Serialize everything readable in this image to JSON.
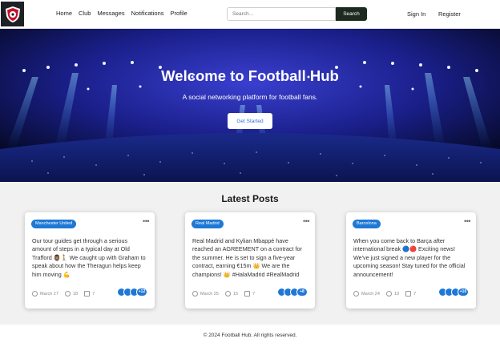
{
  "nav": {
    "items": [
      "Home",
      "Club",
      "Messages",
      "Notifications",
      "Profile"
    ]
  },
  "search": {
    "placeholder": "Search...",
    "button": "Search"
  },
  "auth": {
    "signin": "Sign In",
    "register": "Register"
  },
  "hero": {
    "title": "Welcome to Football Hub",
    "subtitle": "A social networking platform for football fans.",
    "button": "Get Started"
  },
  "posts": {
    "title": "Latest Posts",
    "items": [
      {
        "club": "Manchester United",
        "text": "Our tour guides get through a serious amount of steps in a typical day at Old Trafford 🧔🏽‍♂️🚶 We caught up with Graham to speak about how the Theragun helps keep him moving 💪",
        "date": "March 27",
        "comments": "18",
        "shares": "7",
        "more_count": "+12"
      },
      {
        "club": "Real Madrid",
        "text": "Real Madrid and Kylian Mbappé have reached an AGREEMENT on a contract for the summer. He is set to sign a five-year contract, earning €15m 👑 We are the champions! 👑 #HalaMadrid #RealMadrid",
        "date": "March 25",
        "comments": "15",
        "shares": "7",
        "more_count": "+8"
      },
      {
        "club": "Barcelona",
        "text": "When you come back to Barça after international break 🔵🔴 Exciting news! We've just signed a new player for the upcoming season! Stay tuned for the official announcement!",
        "date": "March 24",
        "comments": "10",
        "shares": "7",
        "more_count": "+10"
      }
    ]
  },
  "footer": {
    "text": "© 2024 Football Hub. All rights reserved."
  },
  "colors": {
    "accent": "#1e78d6",
    "search_button": "#1c2a20",
    "hero_bg": "#0a0f3a"
  }
}
